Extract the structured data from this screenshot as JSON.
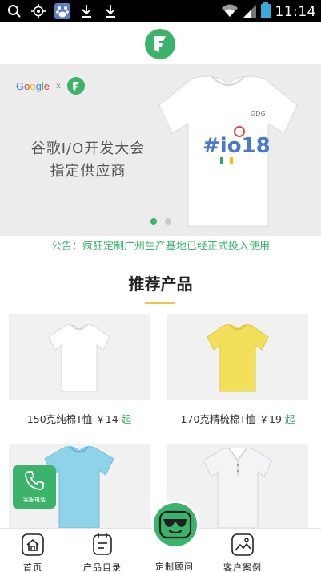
{
  "status_bar": {
    "time": "11:14",
    "icons": [
      "search-icon",
      "location-icon",
      "baidu-icon",
      "download-icon",
      "download-icon",
      "wifi-icon",
      "signal-icon",
      "battery-icon"
    ]
  },
  "header": {
    "logo_icon": "brand-f-logo-icon"
  },
  "banner": {
    "google_text": "Google",
    "x_text": "x",
    "line1": "谷歌I/O开发大会",
    "line2": "指定供应商",
    "shirt_print": "#io18",
    "shirt_tag": "GDG",
    "slide_count": 2,
    "active_slide": 0
  },
  "notice": "公告：疯狂定制广州生产基地已经正式投入使用",
  "section": {
    "title": "推荐产品"
  },
  "products": [
    {
      "name": "150克纯棉T恤",
      "price": "￥14",
      "suffix": "起",
      "color": "#e9e9e9"
    },
    {
      "name": "170克精梳棉T恤",
      "price": "￥19",
      "suffix": "起",
      "color": "#f2df5a"
    },
    {
      "name": "",
      "price": "",
      "suffix": "",
      "color": "#8fd3e8"
    },
    {
      "name": "",
      "price": "",
      "suffix": "",
      "color": "#f4f4f6"
    }
  ],
  "floating": {
    "phone_label": "客服电话"
  },
  "bottom_nav": {
    "items": [
      {
        "label": "首页",
        "icon": "home-icon"
      },
      {
        "label": "产品目录",
        "icon": "catalog-icon"
      },
      {
        "label": "定制顾问",
        "icon": "advisor-icon"
      },
      {
        "label": "客户案例",
        "icon": "gallery-icon"
      }
    ]
  },
  "colors": {
    "brand_green": "#3bb36b",
    "accent_yellow": "#f0c14b"
  }
}
